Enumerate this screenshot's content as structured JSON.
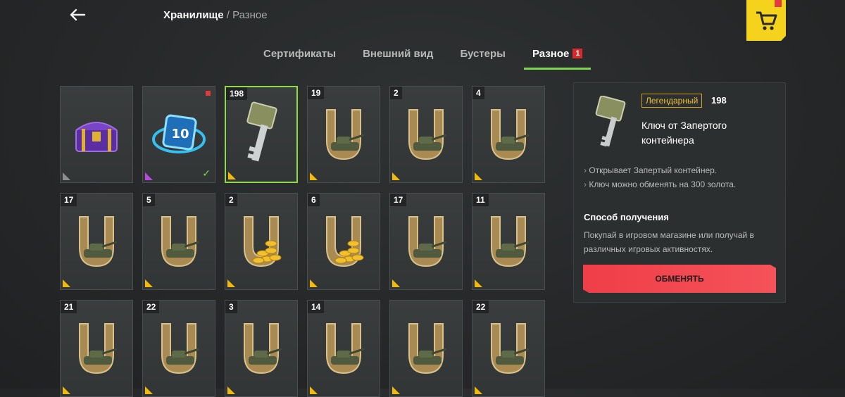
{
  "header": {
    "breadcrumb_current": "Хранилище",
    "breadcrumb_separator": "/",
    "breadcrumb_sub": "Разное"
  },
  "tabs": [
    {
      "label": "Сертификаты",
      "active": false
    },
    {
      "label": "Внешний вид",
      "active": false
    },
    {
      "label": "Бустеры",
      "active": false
    },
    {
      "label": "Разное",
      "active": true,
      "badge": "1"
    }
  ],
  "items": [
    {
      "count": "",
      "art": "chest",
      "rarity": "grey"
    },
    {
      "count": "",
      "art": "ticket10",
      "rarity": "purple",
      "new": true,
      "owned": true,
      "ticket_value": "10"
    },
    {
      "count": "198",
      "art": "key",
      "rarity": "gold",
      "selected": true
    },
    {
      "count": "19",
      "art": "horseshoe-tank",
      "rarity": "gold"
    },
    {
      "count": "2",
      "art": "horseshoe-tank",
      "rarity": "gold"
    },
    {
      "count": "4",
      "art": "horseshoe-tank",
      "rarity": "gold"
    },
    {
      "count": "17",
      "art": "horseshoe-tank",
      "rarity": "gold"
    },
    {
      "count": "5",
      "art": "horseshoe-tank",
      "rarity": "gold"
    },
    {
      "count": "2",
      "art": "horseshoe-gold",
      "rarity": "gold"
    },
    {
      "count": "6",
      "art": "horseshoe-gold",
      "rarity": "gold"
    },
    {
      "count": "17",
      "art": "horseshoe-tank",
      "rarity": "gold"
    },
    {
      "count": "11",
      "art": "horseshoe-tank",
      "rarity": "gold"
    },
    {
      "count": "21",
      "art": "horseshoe-tank",
      "rarity": "gold"
    },
    {
      "count": "22",
      "art": "horseshoe-tank",
      "rarity": "gold"
    },
    {
      "count": "3",
      "art": "horseshoe-tank",
      "rarity": "gold"
    },
    {
      "count": "14",
      "art": "horseshoe-tank",
      "rarity": "gold"
    },
    {
      "count": "",
      "art": "horseshoe-tank",
      "rarity": "gold"
    },
    {
      "count": "22",
      "art": "horseshoe-tank",
      "rarity": "gold"
    }
  ],
  "detail": {
    "rarity": "Легендарный",
    "count": "198",
    "name": "Ключ от Запертого контейнера",
    "bullets": [
      "Открывает Запертый контейнер.",
      "Ключ можно обменять на 300 золота."
    ],
    "how_title": "Способ получения",
    "how_text": "Покупай в игровом магазине или получай в различных игровых активностях.",
    "exchange_label": "ОБМЕНЯТЬ"
  },
  "colors": {
    "accent_green": "#7fd64f",
    "legendary": "#f2c02e",
    "exchange": "#ef3e48",
    "shop": "#f5d21c"
  },
  "icons": [
    "back-arrow-icon",
    "shopping-cart-icon",
    "key-icon",
    "chest-icon",
    "ticket-icon",
    "horseshoe-icon",
    "tank-icon",
    "gold-coins-icon",
    "check-icon"
  ]
}
